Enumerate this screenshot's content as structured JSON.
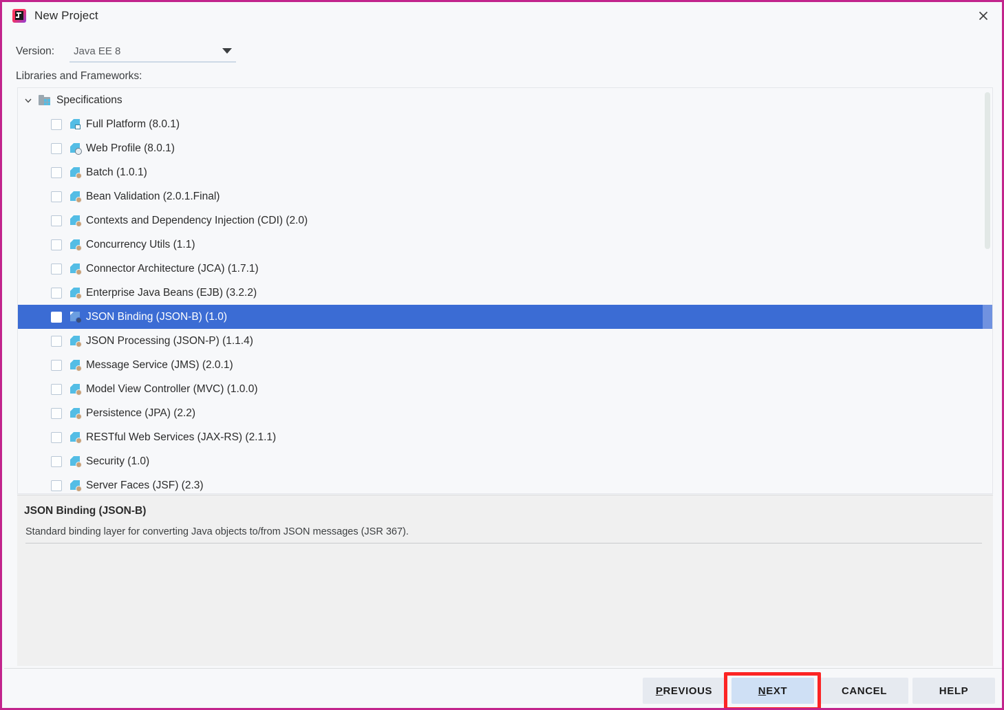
{
  "window": {
    "title": "New Project",
    "logo_icon": "intellij-idea-logo",
    "close_icon": "close-icon"
  },
  "version": {
    "label": "Version:",
    "value": "Java EE 8",
    "arrow_icon": "chevron-down-icon"
  },
  "section": {
    "label": "Libraries and Frameworks:"
  },
  "tree": {
    "root": {
      "label": "Specifications",
      "expanded_icon": "chevron-down-icon",
      "folder_icon": "module-group-folder-icon"
    },
    "items": [
      {
        "label": "Full Platform (8.0.1)",
        "icon": "javaee-full-platform-icon",
        "checked": false,
        "selected": false
      },
      {
        "label": "Web Profile (8.0.1)",
        "icon": "javaee-web-profile-icon",
        "checked": false,
        "selected": false
      },
      {
        "label": "Batch (1.0.1)",
        "icon": "javaee-spec-icon",
        "checked": false,
        "selected": false
      },
      {
        "label": "Bean Validation (2.0.1.Final)",
        "icon": "javaee-spec-icon",
        "checked": false,
        "selected": false
      },
      {
        "label": "Contexts and Dependency Injection (CDI) (2.0)",
        "icon": "javaee-spec-icon",
        "checked": false,
        "selected": false
      },
      {
        "label": "Concurrency Utils (1.1)",
        "icon": "javaee-spec-icon",
        "checked": false,
        "selected": false
      },
      {
        "label": "Connector Architecture (JCA) (1.7.1)",
        "icon": "javaee-spec-icon",
        "checked": false,
        "selected": false
      },
      {
        "label": "Enterprise Java Beans (EJB) (3.2.2)",
        "icon": "javaee-spec-icon",
        "checked": false,
        "selected": false
      },
      {
        "label": "JSON Binding (JSON-B) (1.0)",
        "icon": "javaee-spec-icon",
        "checked": false,
        "selected": true
      },
      {
        "label": "JSON Processing (JSON-P) (1.1.4)",
        "icon": "javaee-spec-icon",
        "checked": false,
        "selected": false
      },
      {
        "label": "Message Service (JMS) (2.0.1)",
        "icon": "javaee-spec-icon",
        "checked": false,
        "selected": false
      },
      {
        "label": "Model View Controller (MVC) (1.0.0)",
        "icon": "javaee-spec-icon",
        "checked": false,
        "selected": false
      },
      {
        "label": "Persistence (JPA) (2.2)",
        "icon": "javaee-spec-icon",
        "checked": false,
        "selected": false
      },
      {
        "label": "RESTful Web Services (JAX-RS) (2.1.1)",
        "icon": "javaee-spec-icon",
        "checked": false,
        "selected": false
      },
      {
        "label": "Security (1.0)",
        "icon": "javaee-spec-icon",
        "checked": false,
        "selected": false
      },
      {
        "label": "Server Faces (JSF) (2.3)",
        "icon": "javaee-spec-icon",
        "checked": false,
        "selected": false
      }
    ]
  },
  "description": {
    "title": "JSON Binding (JSON-B)",
    "text": "Standard binding layer for converting Java objects to/from JSON messages (JSR 367)."
  },
  "footer": {
    "buttons": [
      {
        "id": "previous",
        "label": "PREVIOUS",
        "mnemonic": "P",
        "default": false
      },
      {
        "id": "next",
        "label": "NEXT",
        "mnemonic": "N",
        "default": true
      },
      {
        "id": "cancel",
        "label": "CANCEL",
        "mnemonic": "",
        "default": false
      },
      {
        "id": "help",
        "label": "HELP",
        "mnemonic": "",
        "default": false
      }
    ]
  },
  "annotation": {
    "target": "next-button",
    "color": "#fc2424"
  },
  "colors": {
    "dialog_border": "#c2248c",
    "selection_blue": "#3b6cd4",
    "default_button_blue": "#cfe0f5",
    "icon_cyan": "#54bde5",
    "background": "#f7f8fa",
    "description_background": "#f0f0f0"
  }
}
